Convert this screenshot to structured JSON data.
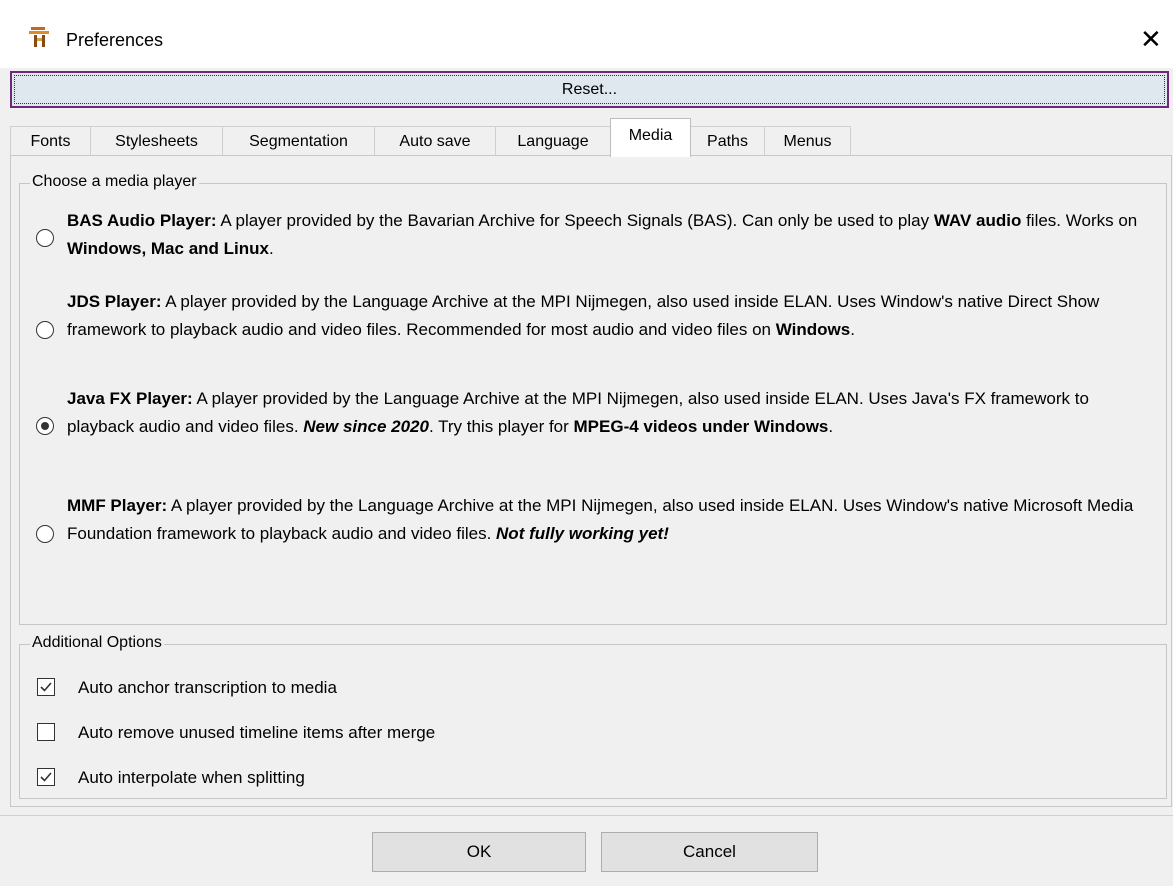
{
  "window": {
    "title": "Preferences",
    "app_icon": "elan-app-icon",
    "close_icon": "close-icon"
  },
  "reset_button": {
    "label": "Reset..."
  },
  "tabs": [
    {
      "label": "Fonts"
    },
    {
      "label": "Stylesheets"
    },
    {
      "label": "Segmentation"
    },
    {
      "label": "Auto save"
    },
    {
      "label": "Language"
    },
    {
      "label": "Media",
      "selected": true
    },
    {
      "label": "Paths"
    },
    {
      "label": "Menus"
    }
  ],
  "media_player_group": {
    "title": "Choose a media player",
    "options": [
      {
        "name": "BAS Audio Player:",
        "selected": false,
        "description": "A player provided by the Bavarian Archive for Speech Signals (BAS). Can only be used to play WAV audio files. Works on Windows, Mac and Linux."
      },
      {
        "name": "JDS Player:",
        "selected": false,
        "description": "A player provided by the Language Archive at the MPI Nijmegen, also used inside ELAN. Uses Window's native Direct Show framework to playback audio and video files. Recommended for most audio and video files on Windows."
      },
      {
        "name": "Java FX Player:",
        "selected": true,
        "description": "A player provided by the Language Archive at the MPI Nijmegen, also used inside ELAN. Uses Java's FX framework to playback audio and video files. New since 2020. Try this player for MPEG-4 videos under Windows."
      },
      {
        "name": "MMF Player:",
        "selected": false,
        "description": "A player provided by the Language Archive at the MPI Nijmegen, also used inside ELAN. Uses Window's native Microsoft Media Foundation framework to playback audio and video files. Not fully working yet!"
      }
    ]
  },
  "additional_options_group": {
    "title": "Additional Options",
    "options": [
      {
        "label": "Auto anchor transcription to media",
        "checked": true
      },
      {
        "label": "Auto remove unused timeline items after merge",
        "checked": false
      },
      {
        "label": "Auto interpolate when splitting",
        "checked": true
      }
    ]
  },
  "footer": {
    "ok_label": "OK",
    "cancel_label": "Cancel"
  }
}
